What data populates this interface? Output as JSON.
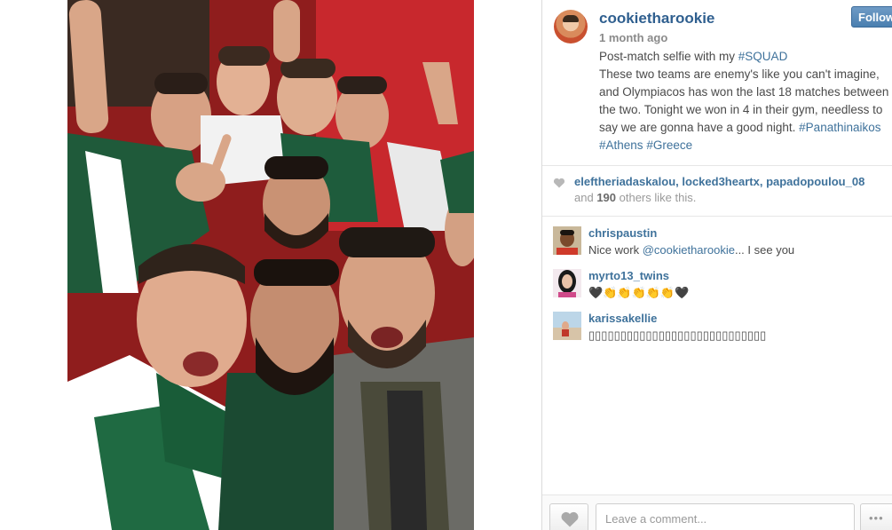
{
  "post": {
    "username": "cookietharookie",
    "follow_label": "Follow",
    "time_ago": "1 month ago",
    "caption": {
      "line1_text": "Post-match selfie with my ",
      "line1_tag": "#SQUAD",
      "body": "These two teams are enemy's like you can't imagine, and Olympiacos has won the last 18 matches between the two. Tonight we won in 4 in their gym, needless to say we are gonna have a good night. ",
      "tag_panathinaikos": "#Panathinaikos",
      "tag_athens": "#Athens",
      "tag_greece": "#Greece"
    }
  },
  "likes": {
    "liker1": "eleftheriadaskalou",
    "liker2": "locked3heartx",
    "liker3": "papadopoulou_08",
    "and": "and ",
    "count": "190",
    "rest": " others like this."
  },
  "comments": [
    {
      "user": "chrispaustin",
      "text_prefix": "Nice work ",
      "mention": "@cookietharookie",
      "text_suffix": "... I see you"
    },
    {
      "user": "myrto13_twins",
      "text": "🖤👏👏👏👏👏🖤"
    },
    {
      "user": "karissakellie",
      "text": "▯▯▯▯▯▯▯▯▯▯▯▯▯▯▯▯▯▯▯▯▯▯▯▯▯▯▯▯"
    }
  ],
  "footer": {
    "comment_placeholder": "Leave a comment...",
    "more_label": "•••"
  },
  "icons": {
    "heart": "heart-icon",
    "more": "more-options-icon"
  },
  "colors": {
    "link": "#3f729b",
    "username": "#2f5f8f",
    "follow_button": "#4a7fb0"
  }
}
